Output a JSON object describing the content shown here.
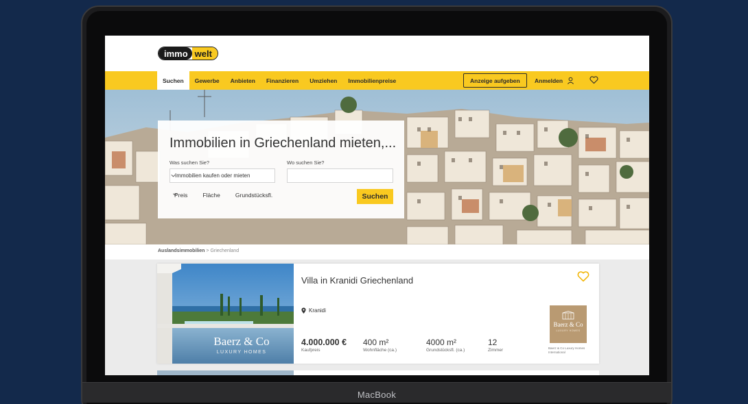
{
  "device": {
    "brand_label": "MacBook"
  },
  "header": {
    "logo_part1": "immo",
    "logo_part2": "welt"
  },
  "nav": {
    "items": [
      {
        "label": "Suchen"
      },
      {
        "label": "Gewerbe"
      },
      {
        "label": "Anbieten"
      },
      {
        "label": "Finanzieren"
      },
      {
        "label": "Umziehen"
      },
      {
        "label": "Immobilienpreise"
      }
    ],
    "active": "Suchen",
    "ad_button": "Anzeige aufgeben",
    "login": "Anmelden"
  },
  "search": {
    "title": "Immobilien in Griechenland mieten,...",
    "what_label": "Was suchen Sie?",
    "what_value": "Immobilien kaufen oder mieten",
    "where_label": "Wo suchen Sie?",
    "where_value": "",
    "filters": [
      "Preis",
      "Fläche",
      "Grundstücksfl."
    ],
    "button": "Suchen"
  },
  "breadcrumb": {
    "parent": "Auslandsimmobilien",
    "separator": " > ",
    "current": "Griechenland"
  },
  "listing": {
    "title": "Villa in Kranidi Griechenland",
    "location": "Kranidi",
    "image_watermark": "Baerz & Co",
    "image_watermark_sub": "LUXURY HOMES",
    "price": "4.000.000 €",
    "price_label": "Kaufpreis",
    "living_area": "400 m²",
    "living_area_label": "Wohnfläche (ca.)",
    "plot_area": "4000 m²",
    "plot_area_label": "Grundstücksfl. (ca.)",
    "rooms": "12",
    "rooms_label": "Zimmer",
    "agent_logo_text": "Baerz & Co",
    "agent_logo_sub": "LUXURY HOMES",
    "agent_name": "Baerz & Co Luxury Homes International"
  },
  "colors": {
    "brand_yellow": "#f9c920",
    "background": "#13294b",
    "heart": "#f2b400"
  }
}
